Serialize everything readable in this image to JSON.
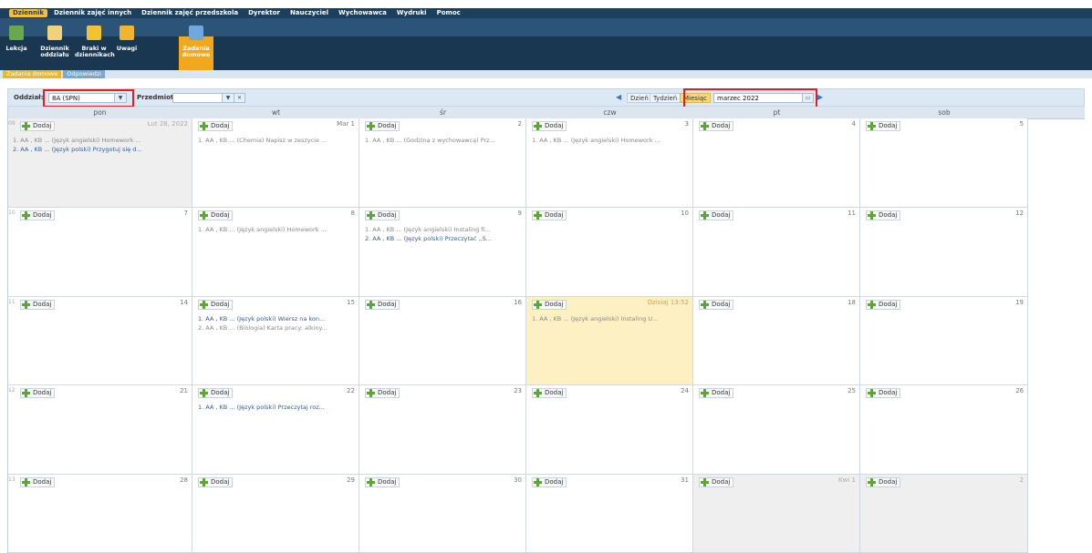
{
  "menu": [
    {
      "label": "Dziennik",
      "active": true
    },
    {
      "label": "Dziennik zajęć innych"
    },
    {
      "label": "Dziennik zajęć przedszkola"
    },
    {
      "label": "Dyrektor"
    },
    {
      "label": "Nauczyciel"
    },
    {
      "label": "Wychowawca"
    },
    {
      "label": "Wydruki"
    },
    {
      "label": "Pomoc"
    }
  ],
  "toolbar": [
    {
      "label": "Lekcja",
      "icon": "lesson-icon",
      "color": "#6aa84f"
    },
    {
      "label": "Dziennik oddziału",
      "icon": "journal-icon",
      "color": "#f1d27a"
    },
    {
      "label": "Braki w dziennikach",
      "icon": "missing-entries-icon",
      "color": "#f1c232"
    },
    {
      "label": "Uwagi",
      "icon": "remarks-icon",
      "color": "#f1b52d"
    },
    {
      "label": "Zadania domowe",
      "icon": "homework-icon",
      "color": "#6fa8dc",
      "active": true
    }
  ],
  "subtabs": [
    {
      "label": "Zadania domowe",
      "active": true
    },
    {
      "label": "Odpowiedzi"
    }
  ],
  "filters": {
    "class_label": "Oddział:",
    "class_value": "8A (SPN)",
    "subject_label": "Przedmiot:",
    "subject_value": "",
    "view_day": "Dzień",
    "view_week": "Tydzień",
    "view_month": "Miesiąc",
    "period": "marzec 2022"
  },
  "weekdays": [
    "pon",
    "wt",
    "śr",
    "czw",
    "pt",
    "sob"
  ],
  "add_label": "Dodaj",
  "weeks": [
    {
      "num": "09",
      "days": [
        {
          "n": "Lut 28, 2022",
          "other": true,
          "entries": [
            {
              "t": "1. AA , KB ... (Język angielski) Homework ...",
              "c": "grey"
            },
            {
              "t": "2. AA , KB ... (Język polski) Przygotuj się d...",
              "c": "blue"
            }
          ]
        },
        {
          "n": "Mar 1",
          "entries": [
            {
              "t": "1. AA , KB ... (Chemia) Napisz w zeszycie ...",
              "c": "grey"
            }
          ]
        },
        {
          "n": "2",
          "entries": [
            {
              "t": "1. AA , KB ... (Godzina z wychowawcą) Prz...",
              "c": "grey"
            }
          ]
        },
        {
          "n": "3",
          "entries": [
            {
              "t": "1. AA , KB ... (Język angielski) Homework ...",
              "c": "grey"
            }
          ]
        },
        {
          "n": "4",
          "entries": []
        },
        {
          "n": "5",
          "entries": []
        }
      ]
    },
    {
      "num": "10",
      "days": [
        {
          "n": "7",
          "entries": []
        },
        {
          "n": "8",
          "entries": [
            {
              "t": "1. AA , KB ... (Język angielski) Homework ...",
              "c": "grey"
            }
          ]
        },
        {
          "n": "9",
          "entries": [
            {
              "t": "1. AA , KB ... (Język angielski) Instaling fi...",
              "c": "grey"
            },
            {
              "t": "2. AA , KB ... (Język polski) Przeczytać ,,S...",
              "c": "blue"
            }
          ]
        },
        {
          "n": "10",
          "entries": []
        },
        {
          "n": "11",
          "entries": []
        },
        {
          "n": "12",
          "entries": []
        }
      ]
    },
    {
      "num": "11",
      "days": [
        {
          "n": "14",
          "entries": []
        },
        {
          "n": "15",
          "entries": [
            {
              "t": "1. AA , KB ... (Język polski) Wiersz na kon...",
              "c": "blue"
            },
            {
              "t": "2. AA , KB ... (Biologia) Karta pracy: alkiny...",
              "c": "grey"
            }
          ]
        },
        {
          "n": "16",
          "entries": []
        },
        {
          "n": "Dzisiaj 13:52",
          "today": true,
          "entries": [
            {
              "t": "1. AA , KB ... (Język angielski) Instaling U...",
              "c": "grey"
            }
          ]
        },
        {
          "n": "18",
          "entries": []
        },
        {
          "n": "19",
          "entries": []
        }
      ]
    },
    {
      "num": "12",
      "days": [
        {
          "n": "21",
          "entries": []
        },
        {
          "n": "22",
          "entries": [
            {
              "t": "1. AA , KB ... (Język polski) Przeczytaj roz...",
              "c": "blue"
            }
          ]
        },
        {
          "n": "23",
          "entries": []
        },
        {
          "n": "24",
          "entries": []
        },
        {
          "n": "25",
          "entries": []
        },
        {
          "n": "26",
          "entries": []
        }
      ]
    },
    {
      "num": "13",
      "days": [
        {
          "n": "28",
          "entries": []
        },
        {
          "n": "29",
          "entries": []
        },
        {
          "n": "30",
          "entries": []
        },
        {
          "n": "31",
          "entries": []
        },
        {
          "n": "Kwi 1",
          "other": true,
          "entries": []
        },
        {
          "n": "2",
          "other": true,
          "entries": []
        }
      ]
    }
  ]
}
